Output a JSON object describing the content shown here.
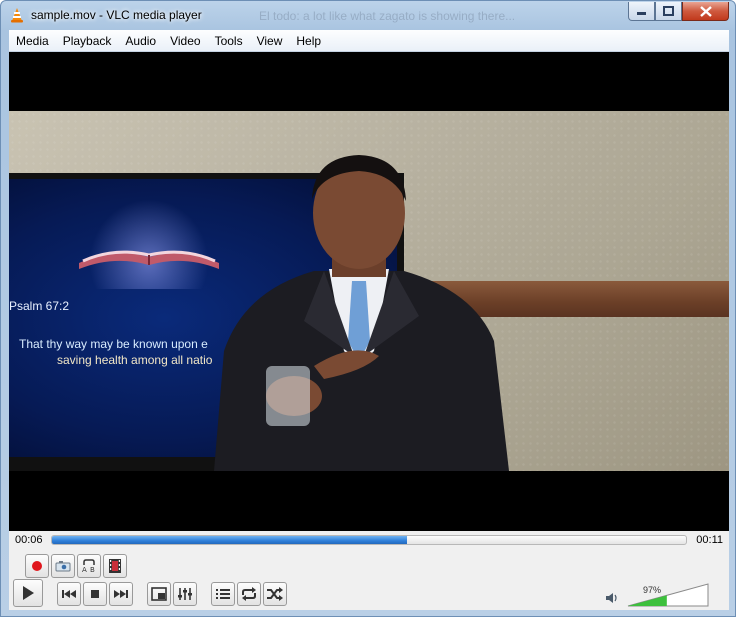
{
  "window": {
    "title": "sample.mov - VLC media player",
    "ghost_title": "El todo: a lot like what zagato is showing there..."
  },
  "menu": [
    "Media",
    "Playback",
    "Audio",
    "Video",
    "Tools",
    "View",
    "Help"
  ],
  "video": {
    "psalm": "Psalm 67:2",
    "verse_line1": "That thy way may be known upon e",
    "verse_line2": "saving health among all natio"
  },
  "playback": {
    "elapsed": "00:06",
    "total": "00:11",
    "progress": 0.56
  },
  "volume": {
    "percent": "97%",
    "level": 0.97
  },
  "colors": {
    "accent": "#2f7fd9",
    "record": "#e0161c",
    "volume": "#3cc03c"
  },
  "icons": {
    "record": "record-icon",
    "snapshot": "camera-icon",
    "loop_ab": "loop-ab-icon",
    "frame_step": "frame-by-frame-icon",
    "play": "play-icon",
    "prev": "skip-back-icon",
    "stop": "stop-icon",
    "next": "skip-forward-icon",
    "fullscreen": "fullscreen-icon",
    "extended": "equalizer-icon",
    "playlist": "playlist-icon",
    "loop": "loop-icon",
    "shuffle": "shuffle-icon",
    "speaker": "speaker-icon"
  }
}
